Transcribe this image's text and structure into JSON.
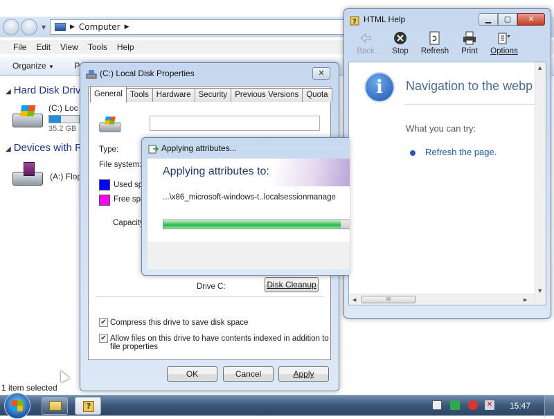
{
  "explorer": {
    "address": "Computer",
    "menu": [
      "File",
      "Edit",
      "View",
      "Tools",
      "Help"
    ],
    "organize": "Organize",
    "organize_tail": "P",
    "sections": {
      "hdd": "Hard Disk Driv",
      "removable": "Devices with R"
    },
    "drive_c": {
      "label": "(C:) Loc",
      "size": "35.2 GB"
    },
    "drive_a": {
      "label": "(A:) Flop"
    },
    "status": "1 item selected"
  },
  "props": {
    "title": "(C:) Local Disk Properties",
    "close": "✕",
    "tabs": [
      "General",
      "Tools",
      "Hardware",
      "Security",
      "Previous Versions",
      "Quota"
    ],
    "type_label": "Type:",
    "fs_label": "File system:",
    "used_label": "Used spa",
    "free_label": "Free spa",
    "capacity_label": "Capacity",
    "drive_label": "Drive C:",
    "cleanup": "Disk Cleanup",
    "compress": "Compress this drive to save disk space",
    "index_line1": "Allow files on this drive to have contents indexed in addition to",
    "index_line2": "file properties",
    "ok": "OK",
    "cancel": "Cancel",
    "apply": "Apply",
    "colors": {
      "used": "#0000ff",
      "free": "#ff00ff"
    }
  },
  "apply_dialog": {
    "title": "Applying attributes...",
    "heading": "Applying attributes to:",
    "file": "...\\x86_microsoft-windows-t..localsessionmanage",
    "progress": 0.95
  },
  "help": {
    "title": "HTML Help",
    "toolbar": [
      "Back",
      "Stop",
      "Refresh",
      "Print",
      "Options"
    ],
    "heading": "Navigation to the webp",
    "try_label": "What you can try:",
    "refresh_link": "Refresh the page.",
    "scroll_grip": "III"
  },
  "taskbar": {
    "clock": "15:47"
  }
}
